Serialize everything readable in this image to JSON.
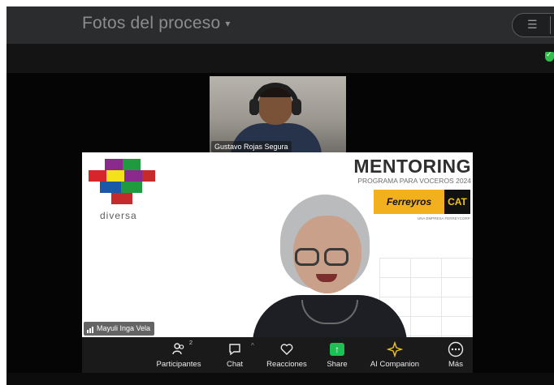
{
  "doc": {
    "title": "Fotos del proceso",
    "caret": "▾"
  },
  "top_participant": {
    "name": "Gustavo Rojas Segura"
  },
  "slide": {
    "logo_text": "diversa",
    "title": "MENTORING",
    "subtitle": "PROGRAMA PARA VOCEROS 2024",
    "ferreyros": "Ferreyros",
    "cat": "CAT",
    "cat_sub": "UNA EMPRESA FERREYCORP",
    "logo_colors": [
      "#8a2a8c",
      "#d6262b",
      "#f3e21b",
      "#1f9a3e",
      "#1a58a8",
      "#c72a2a"
    ]
  },
  "main_participant": {
    "name": "Mayuli Inga Vela"
  },
  "toolbar": {
    "participants_label": "Participantes",
    "participants_count": "2",
    "chat_label": "Chat",
    "reactions_label": "Reacciones",
    "share_label": "Share",
    "ai_label": "AI Companion",
    "more_label": "Más"
  },
  "colors": {
    "share_green": "#1fbf55",
    "ai_yellow": "#f0c419",
    "shield_green": "#2fbf4a"
  }
}
